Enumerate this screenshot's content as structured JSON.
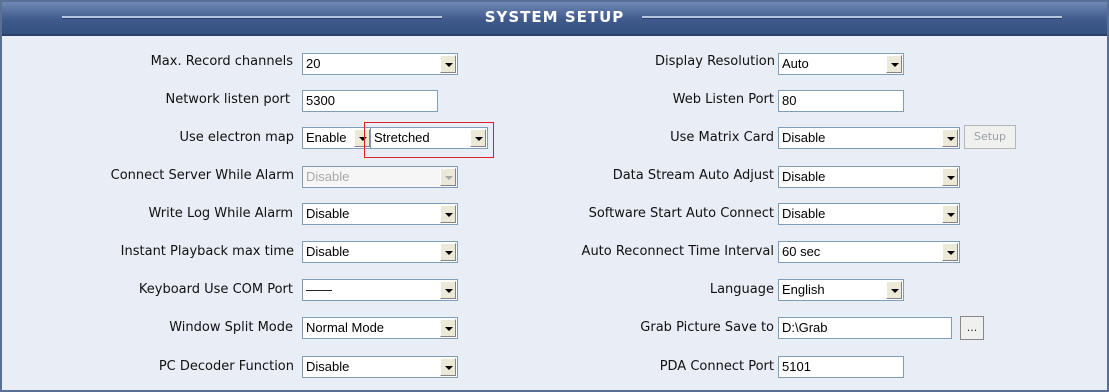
{
  "title": "SYSTEM SETUP",
  "colors": {
    "titlebar": "#3f5a8c",
    "highlight": "#d9232b",
    "field_border": "#7f9db9"
  },
  "left": {
    "max_record_channels": {
      "label": "Max. Record channels",
      "value": "20"
    },
    "network_listen_port": {
      "label": "Network listen port",
      "value": "5300"
    },
    "use_electron_map": {
      "label": "Use electron map",
      "value": "Enable",
      "mode": "Stretched"
    },
    "connect_server_while_alarm": {
      "label": "Connect Server While Alarm",
      "value": "Disable"
    },
    "write_log_while_alarm": {
      "label": "Write Log While Alarm",
      "value": "Disable"
    },
    "instant_playback_max_time": {
      "label": "Instant Playback max time",
      "value": "Disable"
    },
    "keyboard_use_com_port": {
      "label": "Keyboard Use COM Port",
      "value": "——"
    },
    "window_split_mode": {
      "label": "Window Split Mode",
      "value": "Normal Mode"
    },
    "pc_decoder_function": {
      "label": "PC Decoder Function",
      "value": "Disable"
    }
  },
  "right": {
    "display_resolution": {
      "label": "Display Resolution",
      "value": "Auto"
    },
    "web_listen_port": {
      "label": "Web Listen Port",
      "value": "80"
    },
    "use_matrix_card": {
      "label": "Use Matrix Card",
      "value": "Disable",
      "button": "Setup"
    },
    "data_stream_auto_adjust": {
      "label": "Data Stream Auto Adjust",
      "value": "Disable"
    },
    "software_start_auto_connect": {
      "label": "Software Start Auto Connect",
      "value": "Disable"
    },
    "auto_reconnect_time_interval": {
      "label": "Auto Reconnect Time Interval",
      "value": "60 sec"
    },
    "language": {
      "label": "Language",
      "value": "English"
    },
    "grab_picture_save_to": {
      "label": "Grab Picture Save to",
      "value": "D:\\Grab",
      "button": "..."
    },
    "pda_connect_port": {
      "label": "PDA Connect Port",
      "value": "5101"
    }
  }
}
